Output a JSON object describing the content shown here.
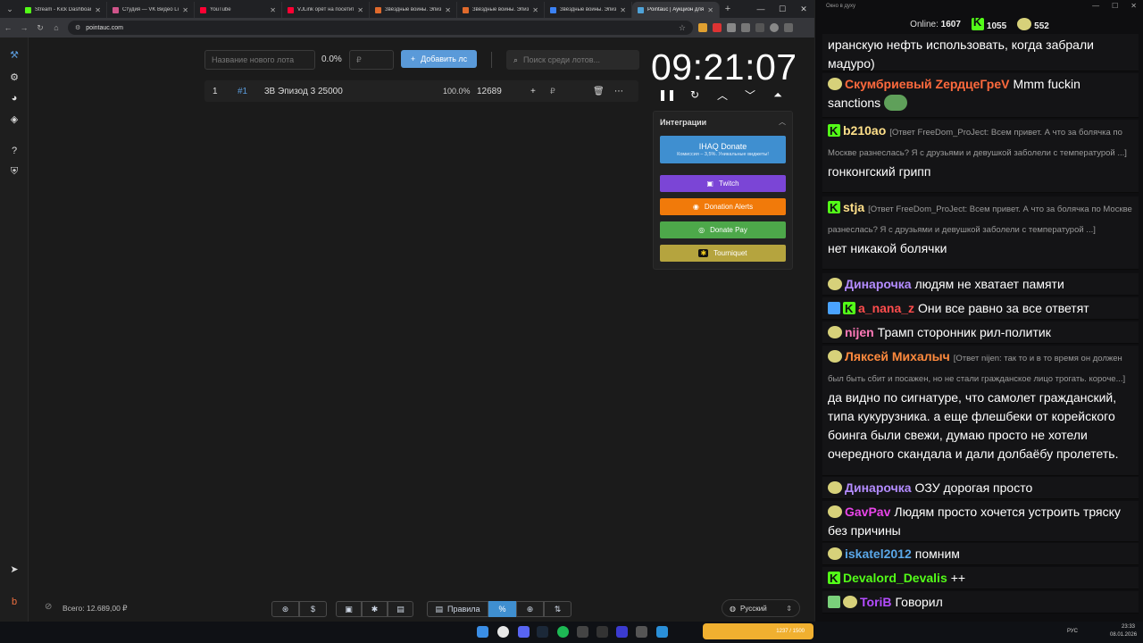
{
  "browser": {
    "tabs": [
      {
        "title": "Stream - Kick Dashboard",
        "color": "#53fc18"
      },
      {
        "title": "Студия — VK Видео Live",
        "color": "#d0548a"
      },
      {
        "title": "YouTube",
        "color": "#ff0033"
      },
      {
        "title": "VJLink орёт на посетителей",
        "color": "#ff0033"
      },
      {
        "title": "Звёздные войны. Эпизод",
        "color": "#e06a2c"
      },
      {
        "title": "Звёздные войны. Эпизод",
        "color": "#e06a2c"
      },
      {
        "title": "Звёздные войны. Эпизод",
        "color": "#3b82f6"
      },
      {
        "title": "Pointauc | Аукцион для стримеров",
        "color": "#4fa3d9"
      }
    ],
    "url": "pointauc.com"
  },
  "auction": {
    "new_lot_placeholder": "Название нового лота",
    "percent": "0.0%",
    "amount_placeholder": "₽",
    "add_button": "Добавить лс",
    "search_placeholder": "Поиск среди лотов...",
    "lot": {
      "index": "1",
      "id": "#1",
      "name": "3В Эпизод 3 25000",
      "percent": "100.0%",
      "amount": "12689",
      "currency": "₽"
    },
    "timer": "09:21:07",
    "integrations_title": "Интеграции",
    "integrations": [
      {
        "label": "IHAQ Donate",
        "sub": "Комиссия – 3,5%. Уникальные виджеты!",
        "color": "#3f8fd0"
      },
      {
        "label": "Twitch",
        "color": "#7b45d6"
      },
      {
        "label": "Donation Alerts",
        "color": "#f17a0a"
      },
      {
        "label": "Donate Pay",
        "color": "#4da84a"
      },
      {
        "label": "Tourniquet",
        "color": "#b5a43e"
      }
    ],
    "total": "Всего: 12.689,00 ₽",
    "rules_button": "Правила",
    "language": "Русский"
  },
  "chat": {
    "window_title": "Окно в духу",
    "online_label": "Online:",
    "online": "1607",
    "kick_count": "1055",
    "other_count": "552",
    "messages": [
      {
        "user": "",
        "color": "#ffffff",
        "text": "иранскую нефть использовать, когда забрали мадуро)"
      },
      {
        "user": "Скумбриевый ZердцеГреV",
        "color": "#ff6a3d",
        "text": "Mmm fuckin sanctions"
      },
      {
        "user": "b210ao",
        "color": "#ffe08a",
        "reply": "[Ответ FreeDom_ProJect: Всем привет. А что за болячка по Москве разнеслась? Я с друзьями и девушкой заболели с температурой ...]",
        "text": "гонконгский грипп"
      },
      {
        "user": "stja",
        "color": "#ffe08a",
        "reply": "[Ответ FreeDom_ProJect: Всем привет. А что за болячка по Москве разнеслась? Я с друзьями и девушкой заболели с температурой ...]",
        "text": "нет никакой болячки"
      },
      {
        "user": "Динарочка",
        "color": "#b48cff",
        "text": "людям не хватает памяти"
      },
      {
        "user": "a_nana_z",
        "color": "#ff4d4d",
        "text": "Они все равно за все ответят"
      },
      {
        "user": "nijen",
        "color": "#ff7ab8",
        "text": "Трамп сторонник рил-политик"
      },
      {
        "user": "Ляксей Михалыч",
        "color": "#ff8a3d",
        "reply": "[Ответ nijen: так то и в то время он должен был быть сбит и посажен, но не стали гражданское лицо трогать. короче...]",
        "text": "да видно по сигнатуре, что самолет гражданский, типа кукурузника. а еще флешбеки от корейского боинга были свежи, думаю просто не хотели очередного скандала и дали долбаёбу пролететь."
      },
      {
        "user": "Динарочка",
        "color": "#b48cff",
        "text": "ОЗУ дорогая просто"
      },
      {
        "user": "GavPav",
        "color": "#e845e8",
        "text": "Людям просто хочется устроить тряску без причины"
      },
      {
        "user": "iskatel2012",
        "color": "#5aa7e8",
        "text": "помним"
      },
      {
        "user": "Devalord_Devalis",
        "color": "#53fc18",
        "text": "++"
      },
      {
        "user": "ToriB",
        "color": "#b44cff",
        "text": "Говорил"
      }
    ]
  },
  "taskbar": {
    "lang": "РУС",
    "time": "23:33",
    "date": "08.01.2026",
    "media": "1237 / 1500"
  }
}
